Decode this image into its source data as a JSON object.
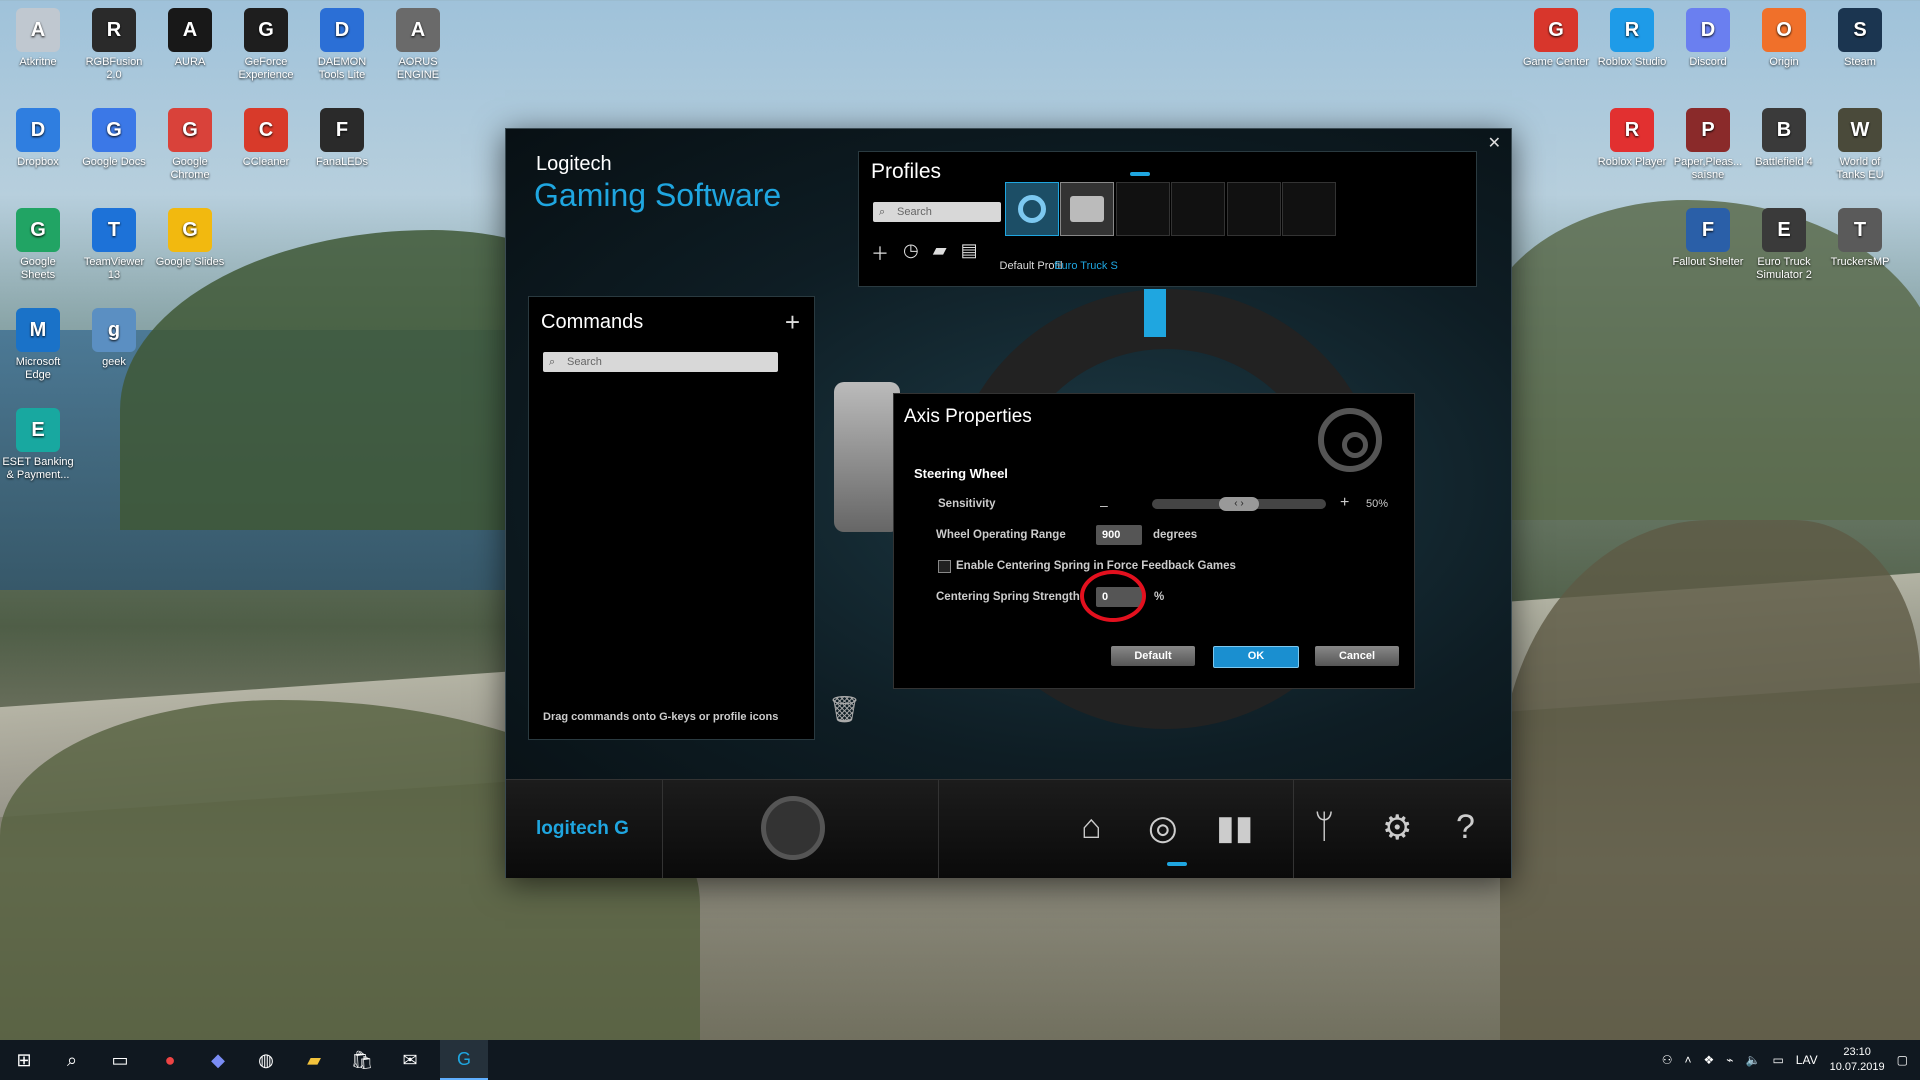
{
  "desktop_icons_left": [
    {
      "label": "Atkritne",
      "icon": "recycle-bin-icon",
      "color": "#c0c8d0"
    },
    {
      "label": "RGBFusion 2.0",
      "icon": "rgb-fusion-icon",
      "color": "#2a2a2a"
    },
    {
      "label": "AURA",
      "icon": "aura-icon",
      "color": "#181818"
    },
    {
      "label": "GeForce Experience",
      "icon": "geforce-icon",
      "color": "#1e1e1e"
    },
    {
      "label": "DAEMON Tools Lite",
      "icon": "daemon-tools-icon",
      "color": "#2b6fd6"
    },
    {
      "label": "AORUS ENGINE",
      "icon": "aorus-icon",
      "color": "#6a6a6a"
    },
    {
      "label": "Dropbox",
      "icon": "dropbox-icon",
      "color": "#2f7ee0"
    },
    {
      "label": "Google Docs",
      "icon": "google-docs-icon",
      "color": "#3b78e7"
    },
    {
      "label": "Google Chrome",
      "icon": "chrome-icon",
      "color": "#d9423a"
    },
    {
      "label": "CCleaner",
      "icon": "ccleaner-icon",
      "color": "#d83a2a"
    },
    {
      "label": "FanaLEDs",
      "icon": "fanaleds-icon",
      "color": "#2a2a2a"
    },
    {
      "label": "Google Sheets",
      "icon": "google-sheets-icon",
      "color": "#21a464"
    },
    {
      "label": "TeamViewer 13",
      "icon": "teamviewer-icon",
      "color": "#1d72d8"
    },
    {
      "label": "Google Slides",
      "icon": "google-slides-icon",
      "color": "#f2b90f"
    },
    {
      "label": "Microsoft Edge",
      "icon": "edge-icon",
      "color": "#1a72c8"
    },
    {
      "label": "geek",
      "icon": "geek-icon",
      "color": "#5b8fc2"
    },
    {
      "label": "ESET Banking & Payment...",
      "icon": "eset-icon",
      "color": "#18a8a0"
    }
  ],
  "desktop_icons_right": [
    {
      "label": "Game Center",
      "icon": "game-center-icon",
      "color": "#d8362c"
    },
    {
      "label": "Roblox Studio",
      "icon": "roblox-studio-icon",
      "color": "#1e9be8"
    },
    {
      "label": "Discord",
      "icon": "discord-icon",
      "color": "#6a7ff0"
    },
    {
      "label": "Origin",
      "icon": "origin-icon",
      "color": "#f0702a"
    },
    {
      "label": "Steam",
      "icon": "steam-icon",
      "color": "#1b3550"
    },
    {
      "label": "Roblox Player",
      "icon": "roblox-player-icon",
      "color": "#e23030"
    },
    {
      "label": "Paper,Pleas... saīsne",
      "icon": "papers-please-icon",
      "color": "#8a2a2a"
    },
    {
      "label": "Battlefield 4",
      "icon": "battlefield-icon",
      "color": "#3a3a3a"
    },
    {
      "label": "World of Tanks EU",
      "icon": "world-of-tanks-icon",
      "color": "#4a4a3a"
    },
    {
      "label": "Fallout Shelter",
      "icon": "fallout-shelter-icon",
      "color": "#2a5fa8"
    },
    {
      "label": "Euro Truck Simulator 2",
      "icon": "ets2-icon",
      "color": "#3a3a3a"
    },
    {
      "label": "TruckersMP",
      "icon": "truckersmp-icon",
      "color": "#5a5a5a"
    }
  ],
  "lgs": {
    "brand_line1": "Logitech",
    "brand_line2": "Gaming Software",
    "close": "✕",
    "profiles": {
      "title": "Profiles",
      "search_placeholder": "Search",
      "default_label": "Default Profil",
      "active_label": "Euro Truck S"
    },
    "commands": {
      "title": "Commands",
      "search_placeholder": "Search",
      "hint": "Drag commands onto G-keys or profile icons"
    },
    "axis": {
      "title": "Axis Properties",
      "section": "Steering Wheel",
      "sensitivity_label": "Sensitivity",
      "sensitivity_value": "50%",
      "sensitivity_fraction": 0.5,
      "range_label": "Wheel Operating Range",
      "range_value": "900",
      "range_unit": "degrees",
      "centering_checkbox_label": "Enable Centering Spring in Force Feedback Games",
      "centering_checked": false,
      "strength_label": "Centering Spring Strength",
      "strength_value": "0",
      "strength_unit": "%",
      "btn_default": "Default",
      "btn_ok": "OK",
      "btn_cancel": "Cancel"
    },
    "bottom": {
      "logo": "logitech G"
    }
  },
  "taskbar": {
    "lang": "LAV",
    "time": "23:10",
    "date": "10.07.2019"
  }
}
